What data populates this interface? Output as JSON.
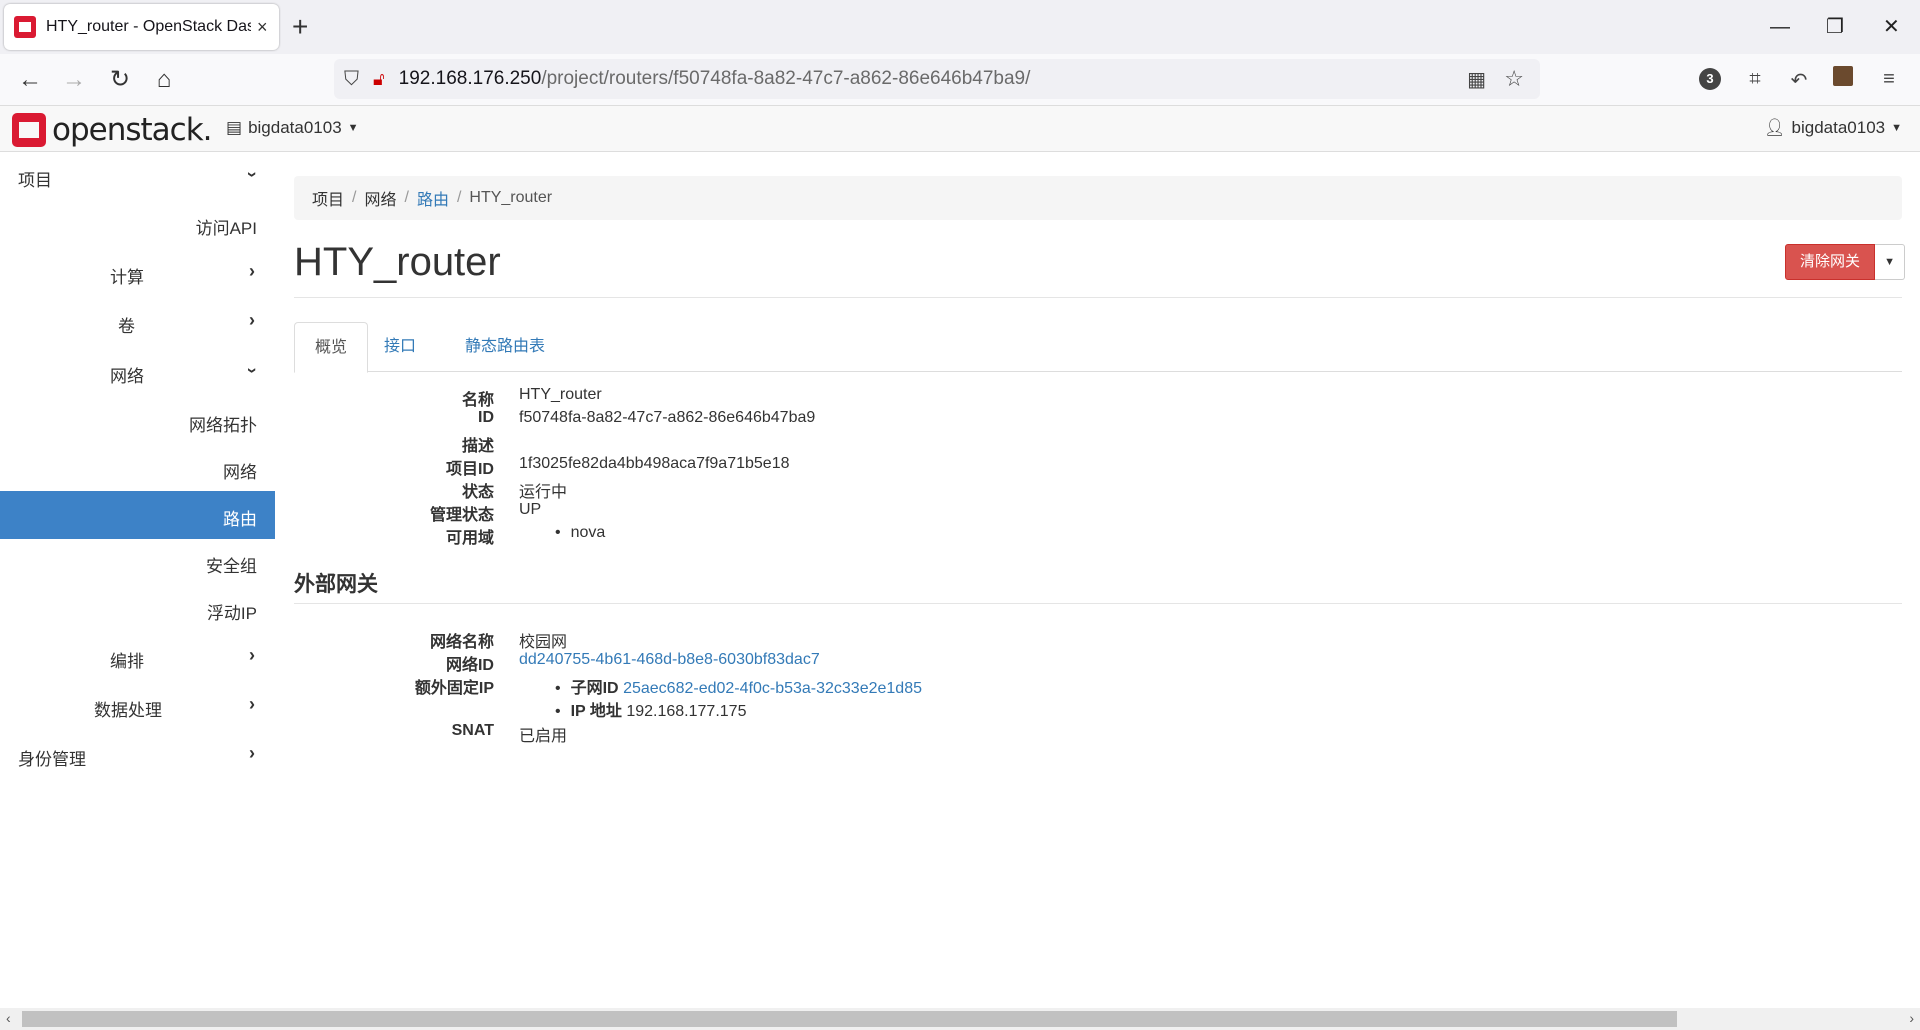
{
  "browser": {
    "tab_title": "HTY_router - OpenStack Dashboard",
    "tab_close": "×",
    "new_tab": "+",
    "url_host": "192.168.176.250",
    "url_path": "/project/routers/f50748fa-8a82-47c7-a862-86e646b47ba9/",
    "extension_badge": "3"
  },
  "header": {
    "logo_text": "openstack.",
    "project": "bigdata0103",
    "user": "bigdata0103"
  },
  "sidebar": {
    "items": [
      {
        "label": "项目",
        "chevron": "⌄"
      },
      {
        "label": "访问API"
      },
      {
        "label": "计算",
        "chevron": "›"
      },
      {
        "label": "卷",
        "chevron": "›"
      },
      {
        "label": "网络",
        "chevron": "⌄"
      },
      {
        "label": "网络拓扑"
      },
      {
        "label": "网络"
      },
      {
        "label": "路由"
      },
      {
        "label": "安全组"
      },
      {
        "label": "浮动IP"
      },
      {
        "label": "编排",
        "chevron": "›"
      },
      {
        "label": "数据处理",
        "chevron": "›"
      },
      {
        "label": "身份管理",
        "chevron": "›"
      }
    ]
  },
  "breadcrumb": {
    "items": [
      "项目",
      "网络",
      "路由",
      "HTY_router"
    ],
    "separator": "/"
  },
  "page": {
    "title": "HTY_router",
    "clear_gateway_button": "清除网关",
    "tabs": [
      "概览",
      "接口",
      "静态路由表"
    ]
  },
  "overview": {
    "name_label": "名称",
    "name_value": "HTY_router",
    "id_label": "ID",
    "id_value": "f50748fa-8a82-47c7-a862-86e646b47ba9",
    "desc_label": "描述",
    "desc_value": "",
    "project_id_label": "项目ID",
    "project_id_value": "1f3025fe82da4bb498aca7f9a71b5e18",
    "status_label": "状态",
    "status_value": "运行中",
    "admin_state_label": "管理状态",
    "admin_state_value": "UP",
    "az_label": "可用域",
    "az_value": "nova"
  },
  "gateway": {
    "heading": "外部网关",
    "net_name_label": "网络名称",
    "net_name_value": "校园网",
    "net_id_label": "网络ID",
    "net_id_value": "dd240755-4b61-468d-b8e8-6030bf83dac7",
    "fixed_ip_label": "额外固定IP",
    "subnet_id_label": "子网ID",
    "subnet_id_value": "25aec682-ed02-4f0c-b53a-32c33e2e1d85",
    "ip_label": "IP 地址",
    "ip_value": "192.168.177.175",
    "snat_label": "SNAT",
    "snat_value": "已启用"
  },
  "colors": {
    "accent": "#3d82c7",
    "danger": "#d9534f",
    "link": "#337ab7",
    "brand": "#da1a32"
  }
}
